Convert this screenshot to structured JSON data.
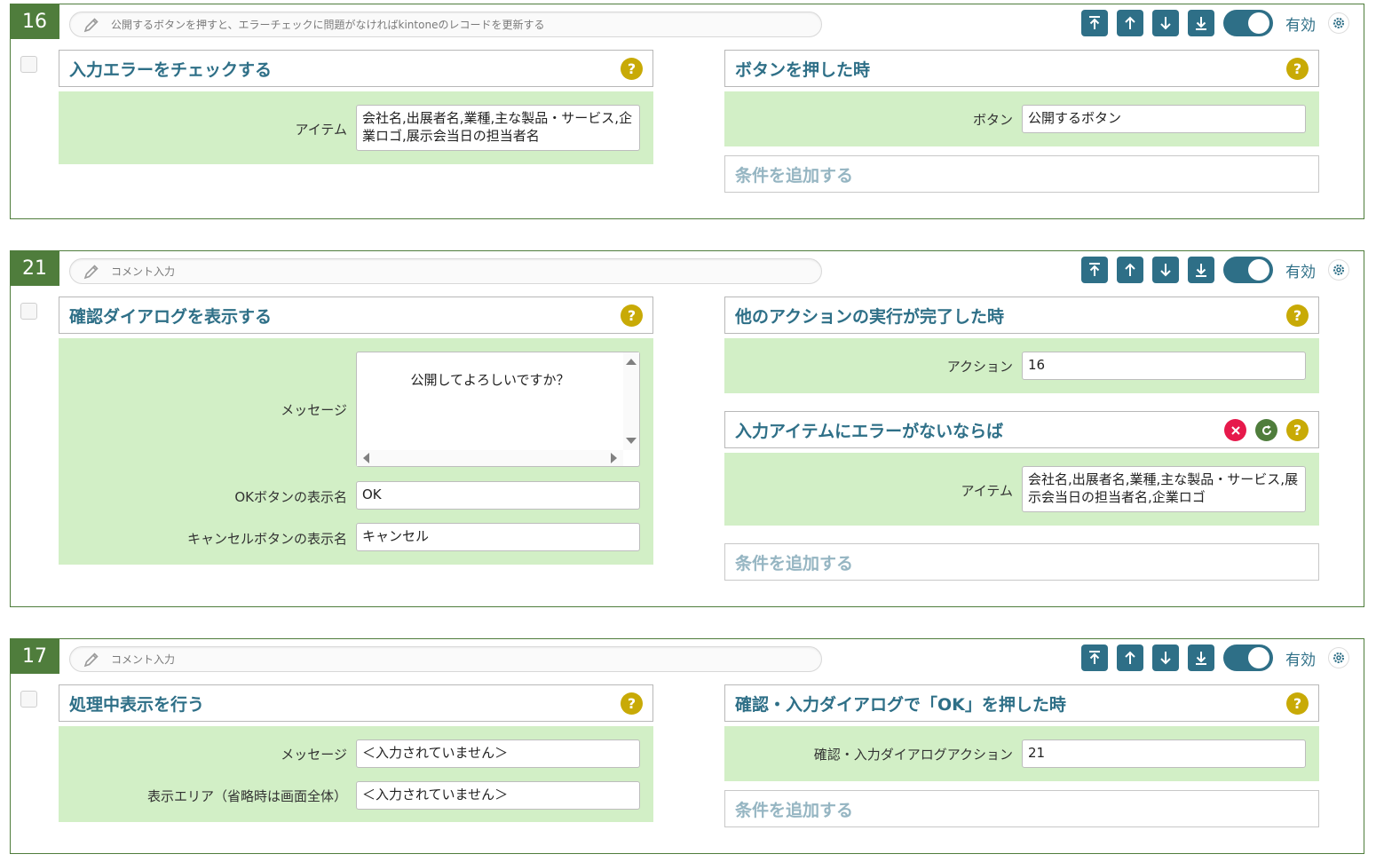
{
  "cards": [
    {
      "number": "16",
      "comment": "公開するボタンを押すと、エラーチェックに問題がなければkintoneのレコードを更新する",
      "status": "有効",
      "action": {
        "title": "入力エラーをチェックする",
        "fields": [
          {
            "label": "アイテム",
            "value": "会社名,出展者名,業種,主な製品・サービス,企業ロゴ,展示会当日の担当者名"
          }
        ]
      },
      "trigger": {
        "title": "ボタンを押した時",
        "fields": [
          {
            "label": "ボタン",
            "value": "公開するボタン"
          }
        ]
      },
      "add_condition": "条件を追加する"
    },
    {
      "number": "21",
      "comment": "コメント入力",
      "status": "有効",
      "action": {
        "title": "確認ダイアログを表示する",
        "fields": [
          {
            "label": "メッセージ",
            "value": "公開してよろしいですか？"
          },
          {
            "label": "OKボタンの表示名",
            "value": "OK"
          },
          {
            "label": "キャンセルボタンの表示名",
            "value": "キャンセル"
          }
        ]
      },
      "trigger": {
        "title": "他のアクションの実行が完了した時",
        "fields": [
          {
            "label": "アクション",
            "value": "16"
          }
        ]
      },
      "condition": {
        "title": "入力アイテムにエラーがないならば",
        "fields": [
          {
            "label": "アイテム",
            "value": "会社名,出展者名,業種,主な製品・サービス,展示会当日の担当者名,企業ロゴ"
          }
        ]
      },
      "add_condition": "条件を追加する"
    },
    {
      "number": "17",
      "comment": "コメント入力",
      "status": "有効",
      "action": {
        "title": "処理中表示を行う",
        "fields": [
          {
            "label": "メッセージ",
            "value": "＜入力されていません＞"
          },
          {
            "label": "表示エリア（省略時は画面全体）",
            "value": "＜入力されていません＞"
          }
        ]
      },
      "trigger": {
        "title": "確認・入力ダイアログで「OK」を押した時",
        "fields": [
          {
            "label": "確認・入力ダイアログアクション",
            "value": "21"
          }
        ]
      },
      "add_condition": "条件を追加する"
    }
  ],
  "colors": {
    "green": "#4f7d3c",
    "teal": "#2e6f87",
    "panel_bg": "#d2efc6",
    "help": "#c8aa06",
    "delete": "#e6194b"
  },
  "icons": [
    "pencil-icon",
    "move-top-icon",
    "move-up-icon",
    "move-down-icon",
    "move-bottom-icon",
    "gear-icon",
    "help-icon",
    "delete-icon",
    "refresh-icon"
  ]
}
